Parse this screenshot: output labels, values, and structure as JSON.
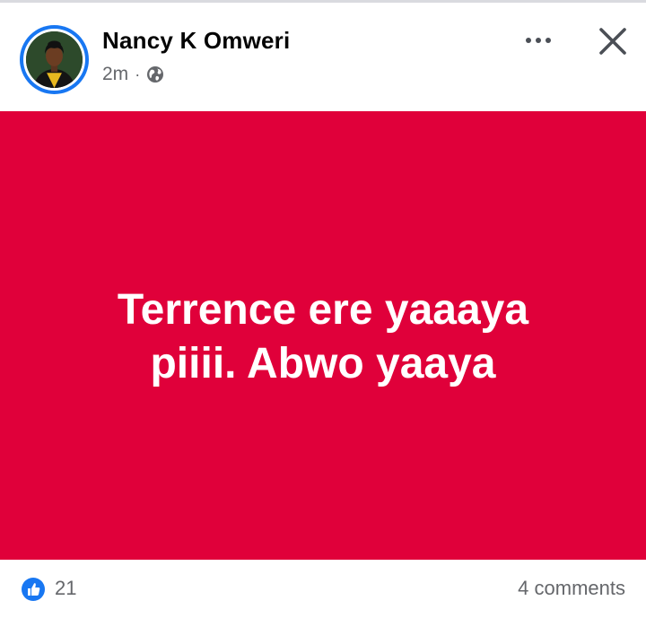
{
  "post": {
    "author": "Nancy K Omweri",
    "time": "2m",
    "separator": "·",
    "audience_icon": "globe-icon",
    "text": "Terrence ere yaaaya piiii. Abwo yaaya",
    "background_color": "#e0003a"
  },
  "header_actions": {
    "more_icon": "more-options-icon",
    "close_icon": "close-icon"
  },
  "footer": {
    "reaction_icon": "like-icon",
    "reaction_count": "21",
    "comments": "4 comments"
  },
  "colors": {
    "accent": "#1877f2",
    "secondary_text": "#65676b"
  }
}
